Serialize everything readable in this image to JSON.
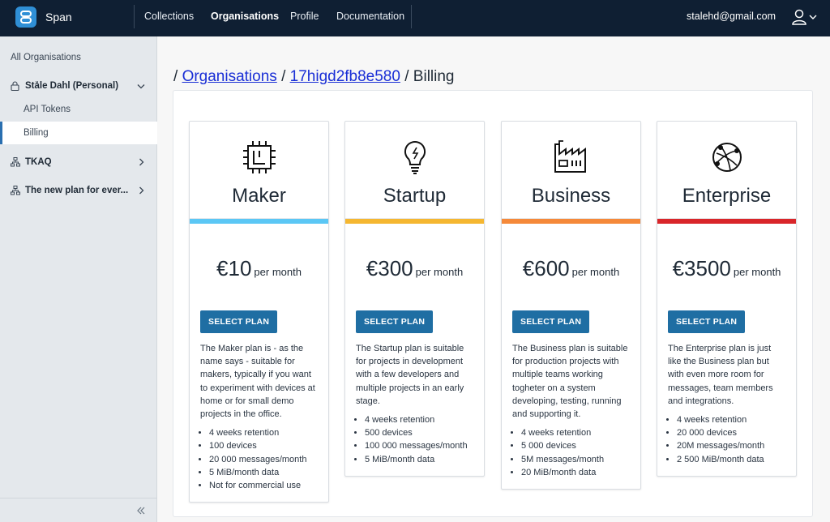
{
  "header": {
    "brand": "Span",
    "nav": [
      {
        "label": "Collections"
      },
      {
        "label": "Organisations"
      },
      {
        "label": "Profile"
      },
      {
        "label": "Documentation"
      }
    ],
    "email": "stalehd@gmail.com"
  },
  "sidebar": {
    "all_label": "All Organisations",
    "orgs": [
      {
        "label": "Ståle Dahl (Personal)",
        "icon": "lock-icon",
        "expanded": true,
        "children": [
          {
            "label": "API Tokens"
          },
          {
            "label": "Billing",
            "active": true
          }
        ]
      },
      {
        "label": "TKAQ",
        "icon": "org-icon",
        "expanded": false
      },
      {
        "label": "The new plan for ever...",
        "icon": "org-icon",
        "expanded": false
      }
    ]
  },
  "breadcrumb": {
    "sep": "/",
    "organisations": "Organisations",
    "org_id": "17higd2fb8e580",
    "current": "Billing"
  },
  "plans": [
    {
      "name": "Maker",
      "icon": "chip-icon",
      "color": "#5bc7f5",
      "price": "€10",
      "per": "per month",
      "button": "SELECT PLAN",
      "description": "The Maker plan is - as the name says - suitable for makers, typically if you want to experiment with devices at home or for small demo projects in the office.",
      "features": [
        "4 weeks retention",
        "100 devices",
        "20 000 messages/month",
        "5 MiB/month data",
        "Not for commercial use"
      ]
    },
    {
      "name": "Startup",
      "icon": "lightbulb-icon",
      "color": "#f5b731",
      "price": "€300",
      "per": "per month",
      "button": "SELECT PLAN",
      "description": "The Startup plan is suitable for projects in development with a few developers and multiple projects in an early stage.",
      "features": [
        "4 weeks retention",
        "500 devices",
        "100 000 messages/month",
        "5 MiB/month data"
      ]
    },
    {
      "name": "Business",
      "icon": "factory-icon",
      "color": "#f5893a",
      "price": "€600",
      "per": "per month",
      "button": "SELECT PLAN",
      "description": "The Business plan is suitable for production projects with multiple teams working togheter on a system developing, testing, running and supporting it.",
      "features": [
        "4 weeks retention",
        "5 000 devices",
        "5M messages/month",
        "20 MiB/month data"
      ]
    },
    {
      "name": "Enterprise",
      "icon": "globe-network-icon",
      "color": "#d9262a",
      "price": "€3500",
      "per": "per month",
      "button": "SELECT PLAN",
      "description": "The Enterprise plan is just like the Business plan but with even more room for messages, team members and integrations.",
      "features": [
        "4 weeks retention",
        "20 000 devices",
        "20M messages/month",
        "2 500 MiB/month data"
      ]
    }
  ]
}
